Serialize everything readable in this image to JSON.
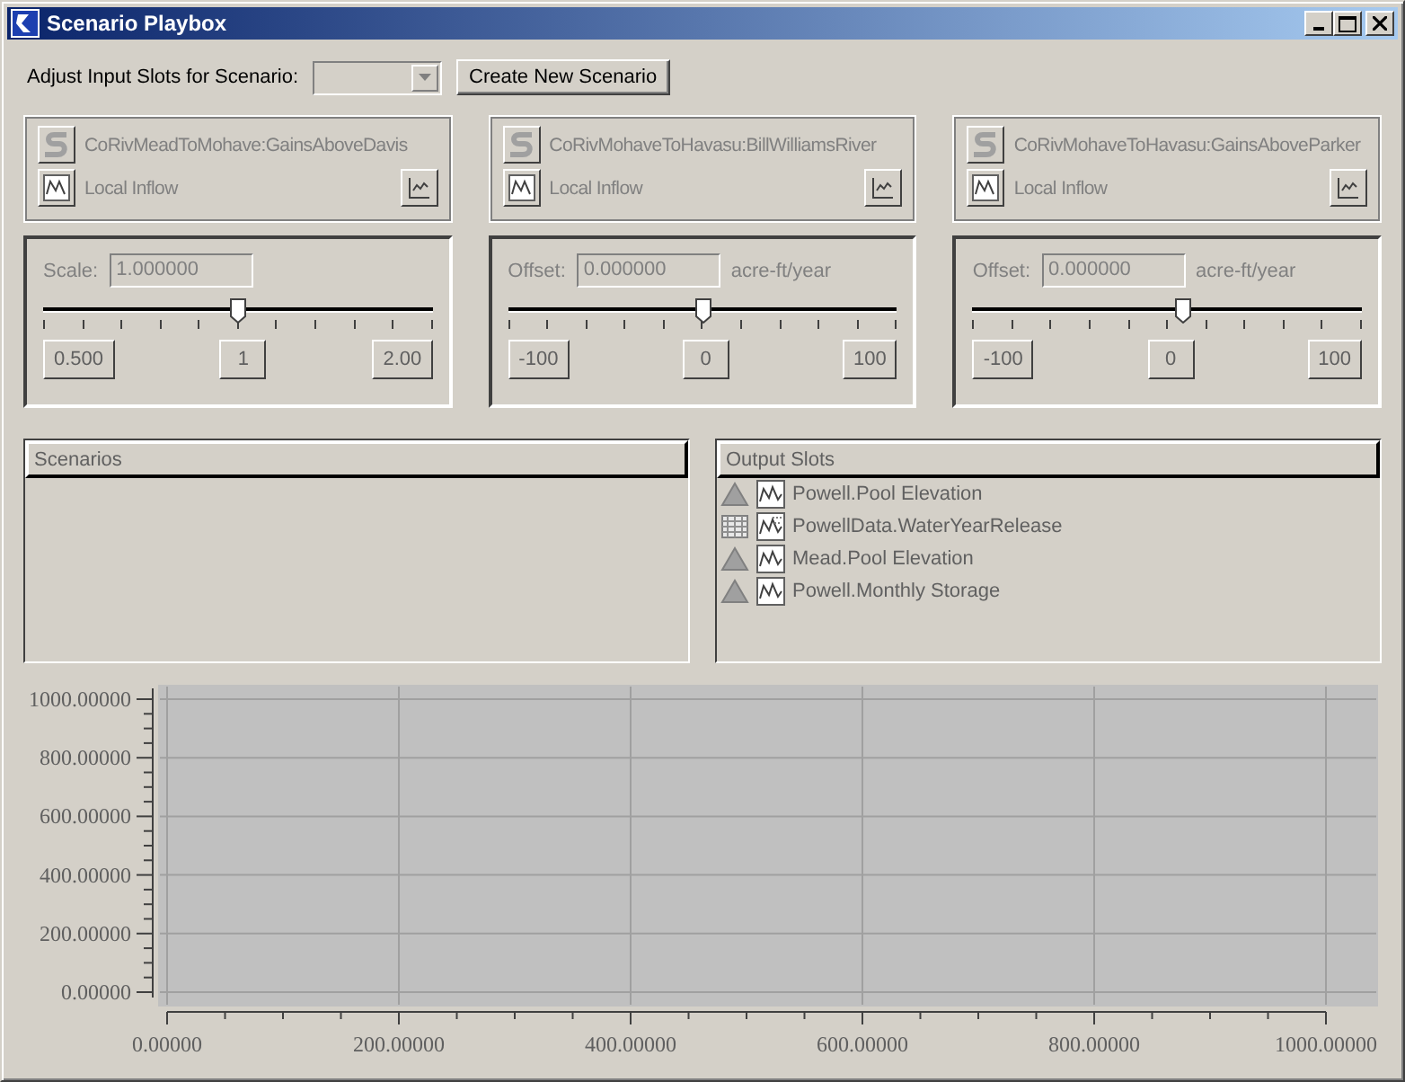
{
  "window": {
    "title": "Scenario Playbox"
  },
  "toolbar": {
    "label": "Adjust Input Slots for Scenario:",
    "create_button": "Create New Scenario"
  },
  "input_slots": [
    {
      "name": "CoRivMeadToMohave:GainsAboveDavis",
      "slot_type": "Local Inflow",
      "control": {
        "label": "Scale:",
        "value": "1.000000",
        "level": 0.5,
        "min": "0.500",
        "mid": "1",
        "max": "2.00"
      }
    },
    {
      "name": "CoRivMohaveToHavasu:BillWilliamsRiver",
      "slot_type": "Local Inflow",
      "control": {
        "label": "Offset:",
        "value": "0.000000",
        "unit": "acre-ft/year",
        "level": 0.5,
        "min": "-100",
        "mid": "0",
        "max": "100"
      }
    },
    {
      "name": "CoRivMohaveToHavasu:GainsAboveParker",
      "slot_type": "Local Inflow",
      "control": {
        "label": "Offset:",
        "value": "0.000000",
        "unit": "acre-ft/year",
        "level": 0.54,
        "min": "-100",
        "mid": "0",
        "max": "100"
      }
    }
  ],
  "scenarios": {
    "header": "Scenarios"
  },
  "output_slots": {
    "header": "Output Slots",
    "items": [
      {
        "kind": "series",
        "label": "Powell.Pool Elevation"
      },
      {
        "kind": "table",
        "label": "PowellData.WaterYearRelease"
      },
      {
        "kind": "series",
        "label": "Mead.Pool Elevation"
      },
      {
        "kind": "series",
        "label": "Powell.Monthly Storage"
      }
    ]
  },
  "plot": {
    "chart_data": {
      "type": "line",
      "grid": true,
      "xlim": [
        0,
        1000
      ],
      "ylim": [
        0,
        1000
      ],
      "xticks": [
        {
          "value": 0,
          "label": "0.00000"
        },
        {
          "value": 200,
          "label": "200.00000"
        },
        {
          "value": 400,
          "label": "400.00000"
        },
        {
          "value": 600,
          "label": "600.00000"
        },
        {
          "value": 800,
          "label": "800.00000"
        },
        {
          "value": 1000,
          "label": "1000.00000"
        }
      ],
      "yticks": [
        {
          "value": 0,
          "label": "0.00000"
        },
        {
          "value": 200,
          "label": "200.00000"
        },
        {
          "value": 400,
          "label": "400.00000"
        },
        {
          "value": 600,
          "label": "600.00000"
        },
        {
          "value": 800,
          "label": "800.00000"
        },
        {
          "value": 1000,
          "label": "1000.00000"
        }
      ]
    }
  }
}
